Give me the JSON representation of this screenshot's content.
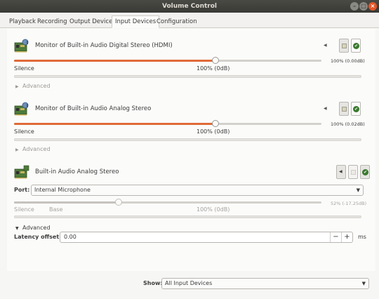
{
  "window": {
    "title": "Volume Control",
    "min_glyph": "–",
    "max_glyph": "□",
    "close_glyph": "×"
  },
  "tabs": [
    {
      "label": "Playback",
      "active": false
    },
    {
      "label": "Recording",
      "active": false
    },
    {
      "label": "Output Devices",
      "active": false
    },
    {
      "label": "Input Devices",
      "active": true
    },
    {
      "label": "Configuration",
      "active": false
    }
  ],
  "devices": [
    {
      "name": "Monitor of Built-in Audio Digital Stereo (HDMI)",
      "icon": "sound-card-icon",
      "volume_percent": 100,
      "percent_readout": "100% (0.00dB)",
      "silence_label": "Silence",
      "center_label": "100% (0dB)",
      "advanced_label": "Advanced"
    },
    {
      "name": "Monitor of Built-in Audio Analog Stereo",
      "icon": "sound-card-icon",
      "volume_percent": 100,
      "percent_readout": "100% (0.02dB)",
      "silence_label": "Silence",
      "center_label": "100% (0dB)",
      "advanced_label": "Advanced"
    },
    {
      "name": "Built-in Audio Analog Stereo",
      "icon": "sound-card-icon",
      "port_label": "Port:",
      "port_value": "Internal Microphone",
      "volume_percent": 52,
      "percent_readout": "52% (-17.25dB)",
      "silence_label": "Silence",
      "base_label": "Base",
      "center_label": "100% (0dB)",
      "advanced_label": "Advanced",
      "latency_label": "Latency offset:",
      "latency_value": "0.00",
      "latency_unit": "ms",
      "minus_glyph": "−",
      "plus_glyph": "+"
    }
  ],
  "footer": {
    "show_label": "Show:",
    "show_value": "All Input Devices"
  },
  "colors": {
    "accent": "#e06a38",
    "titlebar": "#3c3b37",
    "close": "#e2572a",
    "default_check": "#3a7a2f"
  }
}
